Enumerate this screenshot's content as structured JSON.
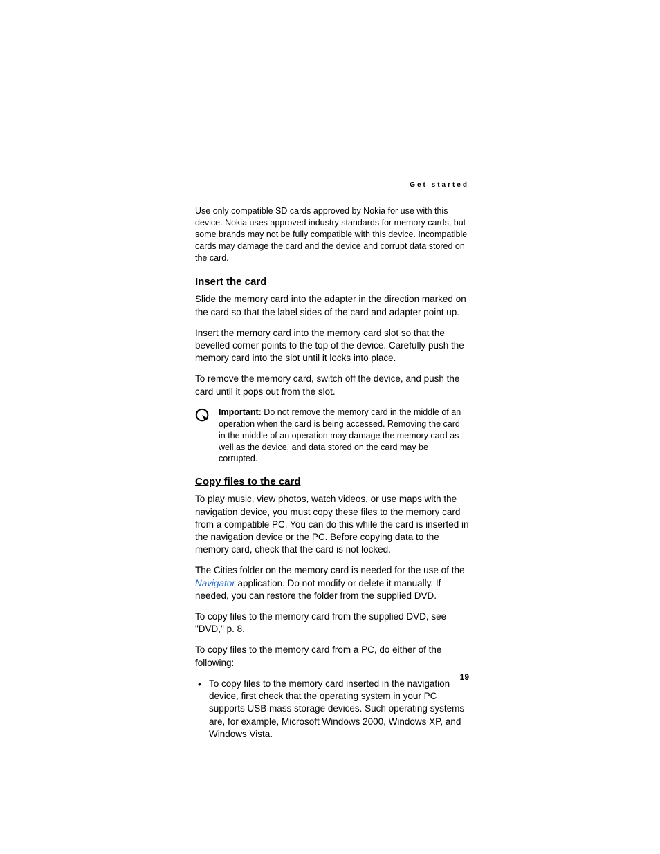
{
  "header": {
    "running": "Get started"
  },
  "intro": "Use only compatible SD cards approved by Nokia for use with this device. Nokia uses approved industry standards for memory cards, but some brands may not be fully compatible with this device. Incompatible cards may damage the card and the device and corrupt data stored on the card.",
  "section1": {
    "heading": "Insert the card",
    "p1": "Slide the memory card into the adapter in the direction marked on the card so that the label sides of the card and adapter point up.",
    "p2": "Insert the memory card into the memory card slot so that the bevelled corner points to the top of the device. Carefully push the memory card into the slot until it locks into place.",
    "p3": "To remove the memory card, switch off the device, and push the card until it pops out from the slot.",
    "important_label": "Important:",
    "important_text": " Do not remove the memory card in the middle of an operation when the card is being accessed. Removing the card in the middle of an operation may damage the memory card as well as the device, and data stored on the card may be corrupted."
  },
  "section2": {
    "heading": "Copy files to the card",
    "p1": "To play music, view photos, watch videos, or use maps with the navigation device, you must copy these files to the memory card from a compatible PC. You can do this while the card is inserted in the navigation device or the PC. Before copying data to the memory card, check that the card is not locked.",
    "p2_pre": "The Cities folder on the memory card is needed for the use of the ",
    "p2_link": "Navigator",
    "p2_post": " application. Do not modify or delete it manually. If needed, you can restore the folder from the supplied DVD.",
    "p3": "To copy files to the memory card from the supplied DVD, see \"DVD,\" p. 8.",
    "p4": "To copy files to the memory card from a PC, do either of the following:",
    "bullet1": "To copy files to the memory card inserted in the navigation device, first check that the operating system in your PC supports USB mass storage devices. Such operating systems are, for example, Microsoft Windows 2000, Windows XP, and Windows Vista."
  },
  "page_number": "19"
}
